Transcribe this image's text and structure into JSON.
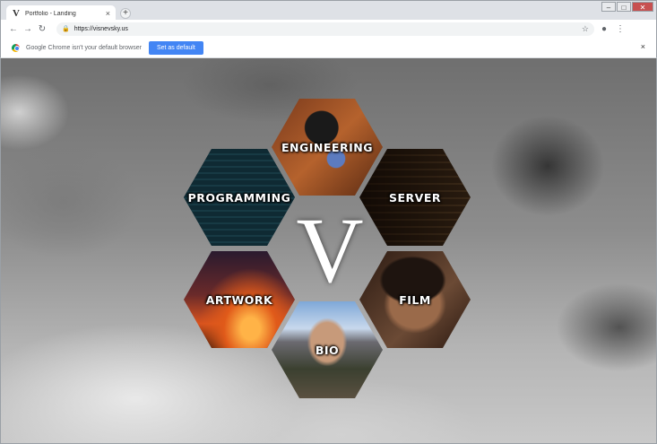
{
  "browser": {
    "tab": {
      "favicon": "V",
      "title": "Portfolio - Landing",
      "close": "×"
    },
    "new_tab": "+",
    "window_controls": {
      "minimize": "–",
      "maximize": "□",
      "close": "✕"
    },
    "nav": {
      "back": "←",
      "forward": "→",
      "reload": "↻"
    },
    "url": "https://visnevsky.us",
    "star": "☆",
    "profile": "●",
    "menu": "⋮"
  },
  "infobar": {
    "text": "Google Chrome isn't your default browser",
    "button": "Set as default",
    "close": "×"
  },
  "page": {
    "logo": "V",
    "hexes": [
      {
        "key": "engineering",
        "label": "ENGINEERING"
      },
      {
        "key": "server",
        "label": "SERVER"
      },
      {
        "key": "programming",
        "label": "PROGRAMMING"
      },
      {
        "key": "artwork",
        "label": "ARTWORK"
      },
      {
        "key": "film",
        "label": "FILM"
      },
      {
        "key": "bio",
        "label": "BIO"
      }
    ]
  }
}
